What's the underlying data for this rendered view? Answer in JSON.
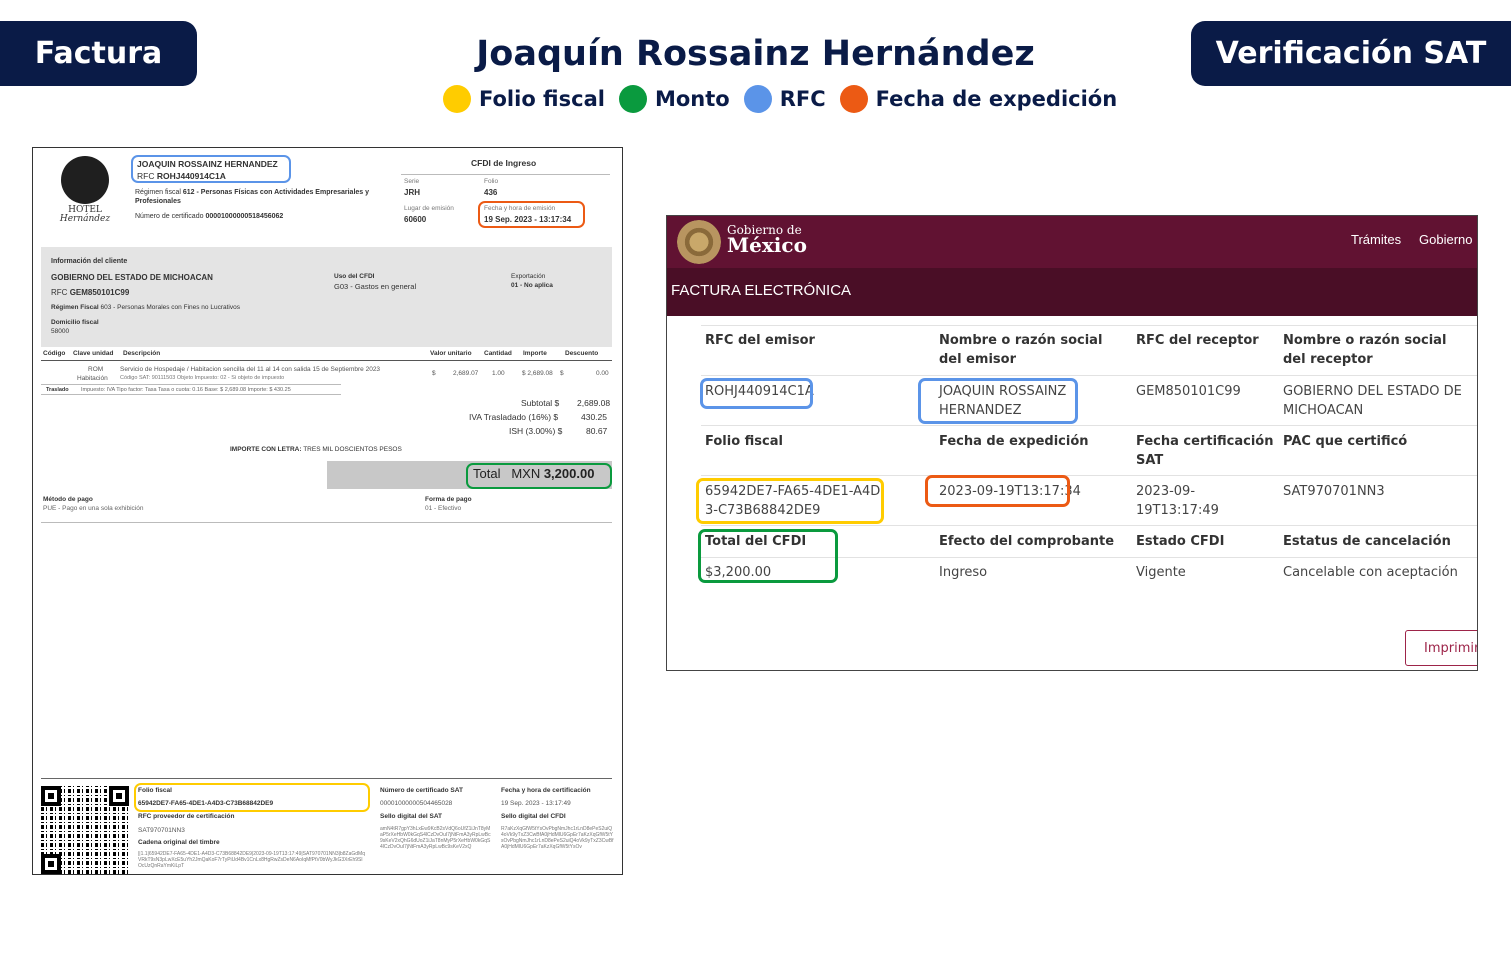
{
  "tabs": {
    "left": "Factura",
    "right": "Verificación SAT"
  },
  "title": "Joaquín Rossainz Hernández",
  "legend": [
    {
      "label": "Folio fiscal",
      "color": "#ffcc00"
    },
    {
      "label": "Monto",
      "color": "#0a9a3e"
    },
    {
      "label": "RFC",
      "color": "#5b94e8"
    },
    {
      "label": "Fecha de expedición",
      "color": "#ec5a14"
    }
  ],
  "invoice": {
    "logo": {
      "line1": "HOTEL",
      "line2": "Hernández"
    },
    "issuer_name": "JOAQUIN ROSSAINZ HERNANDEZ",
    "issuer_rfc_label": "RFC",
    "issuer_rfc": "ROHJ440914C1A",
    "regimen_label": "Régimen fiscal",
    "regimen_code": "612",
    "regimen_desc": "- Personas Físicas con Actividades Empresariales y",
    "regimen_desc2": "Profesionales",
    "cert_label": "Número de certificado",
    "cert_number": "00001000000518456062",
    "cfdi_type": "CFDI de Ingreso",
    "serie_label": "Serie",
    "serie": "JRH",
    "folio_label": "Folio",
    "folio": "436",
    "lugar_label": "Lugar de emisión",
    "lugar": "60600",
    "fecha_label": "Fecha y hora de emisión",
    "fecha": "19 Sep. 2023 - 13:17:34",
    "client_section": "Información del cliente",
    "client_name": "GOBIERNO DEL ESTADO DE MICHOACAN",
    "client_rfc_label": "RFC",
    "client_rfc": "GEM850101C99",
    "client_regimen_label": "Régimen Fiscal",
    "client_regimen": "603 - Personas Morales con Fines no Lucrativos",
    "domicilio_label": "Domicilio fiscal",
    "domicilio": "58000",
    "uso_label": "Uso del CFDI",
    "uso": "G03 - Gastos en general",
    "export_label": "Exportación",
    "export": "01 - No aplica",
    "table_headers": [
      "Código",
      "Clave unidad",
      "Descripción",
      "Valor unitario",
      "Cantidad",
      "Importe",
      "Descuento"
    ],
    "item": {
      "clave": "ROM",
      "unidad": "Habitación",
      "desc1": "Servicio de Hospedaje / Habitacion sencilla del 11 al 14 con salida 15 de Septiembre 2023",
      "desc2": "Código SAT: 90111503 Objeto Impuesto: 02 - Si objeto de impuesto",
      "cur1": "$",
      "valor": "2,689.07",
      "cantidad": "1.00",
      "importe": "$ 2,689.08",
      "cur2": "$",
      "descuento": "0.00"
    },
    "traslado_label": "Traslado",
    "traslado": "Impuesto: IVA    Tipo factor: Tasa    Tasa o cuota: 0.16    Base: $ 2,689.08  Importe: $ 430.25",
    "subtotal_label": "Subtotal $",
    "subtotal": "2,689.08",
    "iva_label": "IVA Trasladado (16%) $",
    "iva": "430.25",
    "isr_label": "ISH (3.00%) $",
    "isr": "80.67",
    "letra_label": "IMPORTE CON LETRA:",
    "letra": "TRES MIL DOSCIENTOS PESOS",
    "total_label": "Total",
    "total_currency": "MXN",
    "total": "3,200.00",
    "metodo_label": "Método de pago",
    "metodo": "PUE - Pago en una sola exhibición",
    "forma_label": "Forma de pago",
    "forma": "01 - Efectivo",
    "folio_fiscal_label": "Folio fiscal",
    "folio_fiscal": "65942DE7-FA65-4DE1-A4D3-C73B68842DE9",
    "rfc_prov_label": "RFC proveedor de certificación",
    "rfc_prov": "SAT970701NN3",
    "cadena_label": "Cadena original del timbre",
    "cert_sat_label": "Número de certificado SAT",
    "cert_sat": "00001000000504465028",
    "fecha_cert_label": "Fecha y hora de certificación",
    "fecha_cert": "19 Sep. 2023 - 13:17:49",
    "sello_sat_label": "Sello digital del SAT",
    "sello_cfdi_label": "Sello digital del CFDI"
  },
  "sat": {
    "gob_small": "Gobierno de",
    "gob_big": "México",
    "nav": [
      "Trámites",
      "Gobierno"
    ],
    "subtitle": "FACTURA ELECTRÓNICA",
    "headers1": [
      "RFC del emisor",
      "Nombre o razón social del emisor",
      "RFC del receptor",
      "Nombre o razón social del receptor"
    ],
    "values1": [
      "ROHJ440914C1A",
      "JOAQUIN ROSSAINZ HERNANDEZ",
      "GEM850101C99",
      "GOBIERNO DEL ESTADO DE MICHOACAN"
    ],
    "headers2": [
      "Folio fiscal",
      "Fecha de expedición",
      "Fecha certificación SAT",
      "PAC que certificó"
    ],
    "values2": [
      "65942DE7-FA65-4DE1-A4D3-C73B68842DE9",
      "2023-09-19T13:17:34",
      "2023-09-19T13:17:49",
      "SAT970701NN3"
    ],
    "headers3": [
      "Total del CFDI",
      "Efecto del comprobante",
      "Estado CFDI",
      "Estatus de cancelación"
    ],
    "values3": [
      "$3,200.00",
      "Ingreso",
      "Vigente",
      "Cancelable con aceptación"
    ],
    "print_button": "Imprimir"
  }
}
